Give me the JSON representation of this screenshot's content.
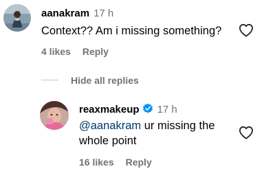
{
  "comment1": {
    "username": "aanakram",
    "time": "17 h",
    "text": "Context?? Am i missing something?",
    "likes": "4 likes",
    "reply": "Reply"
  },
  "hide_replies": "Hide all replies",
  "comment2": {
    "username": "reaxmakeup",
    "time": "17 h",
    "mention": "@aanakram",
    "text_line1": "ur missing the",
    "text_line2": "whole point",
    "likes": "16 likes",
    "reply": "Reply"
  },
  "colors": {
    "secondary_text": "#737373",
    "mention": "#00376b",
    "verified": "#0095f6"
  },
  "icons": [
    "heart-outline-icon",
    "verified-badge-icon"
  ]
}
